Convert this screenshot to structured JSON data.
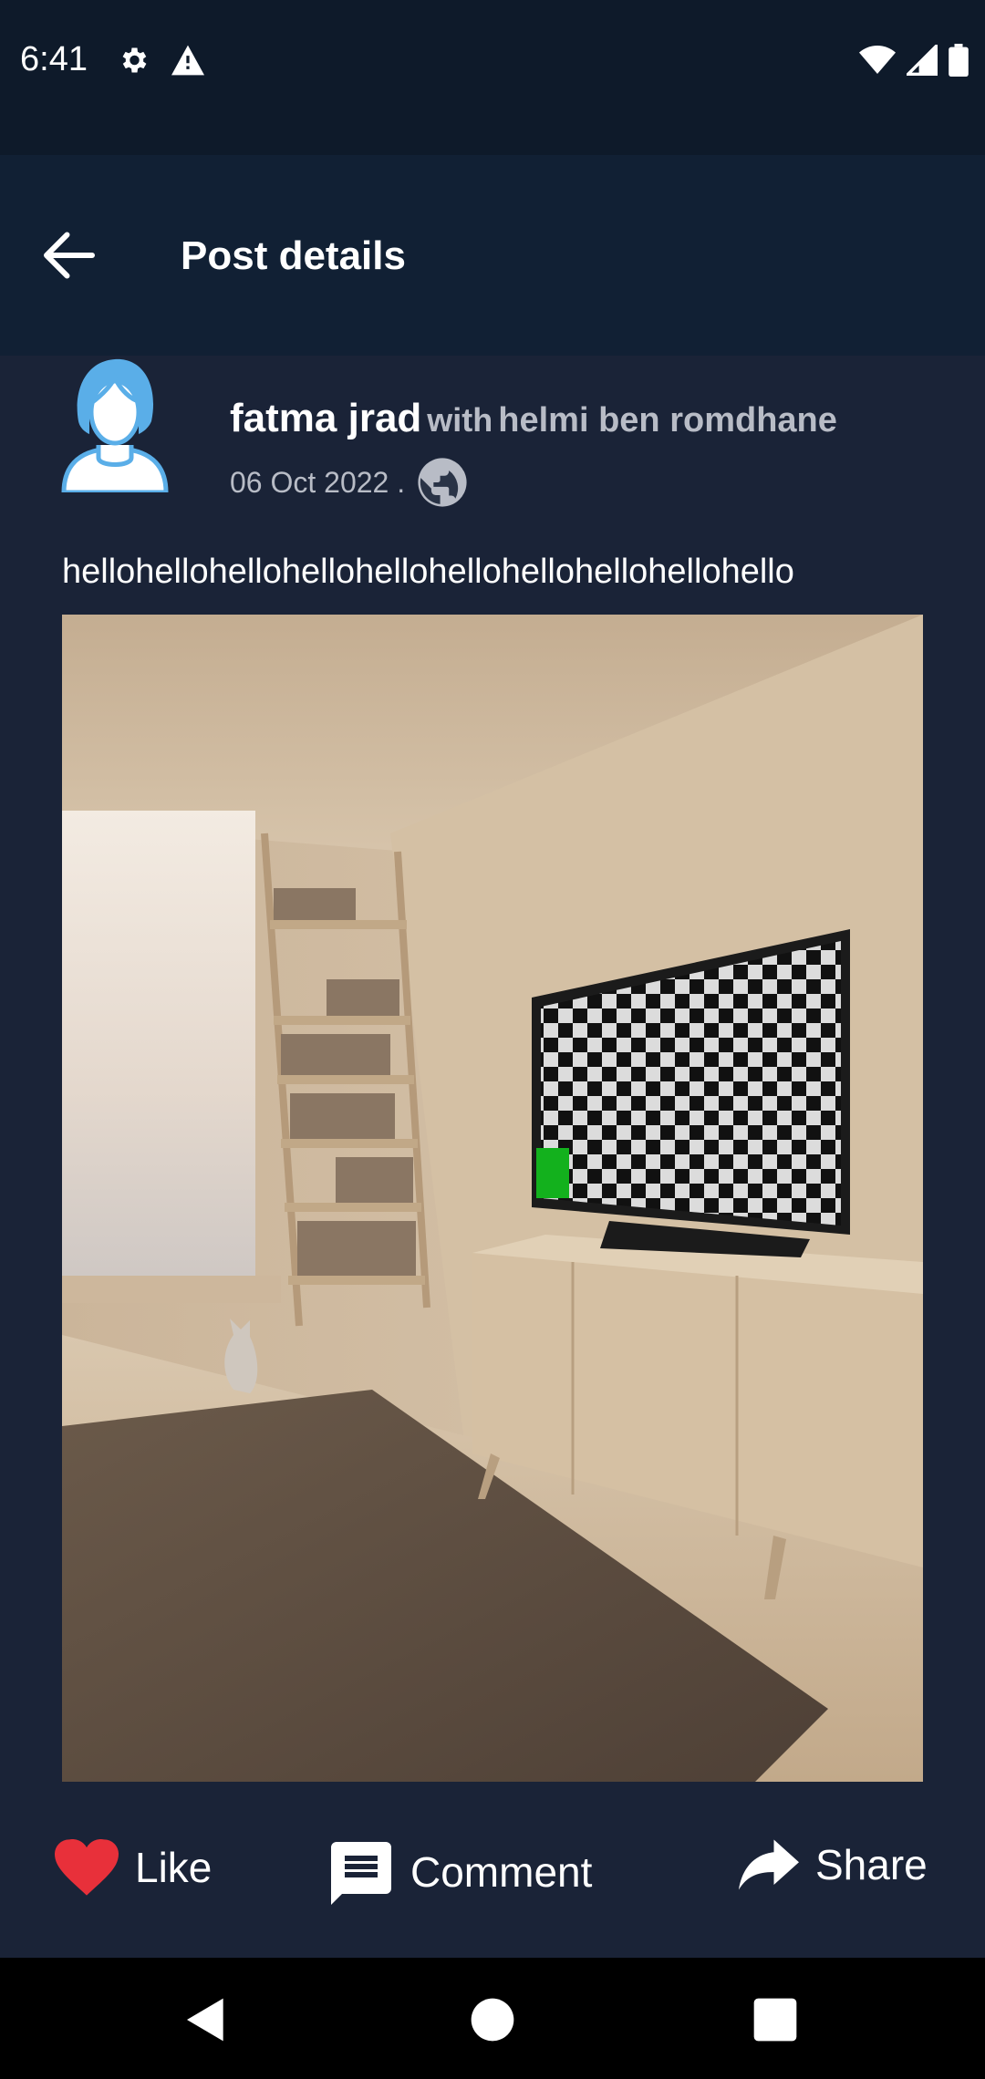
{
  "status_bar": {
    "time": "6:41",
    "icons_left": [
      "gear-icon",
      "warning-icon"
    ],
    "icons_right": [
      "wifi-icon",
      "signal-icon",
      "battery-icon"
    ]
  },
  "app_bar": {
    "back_icon": "arrow-left-icon",
    "title": "Post details"
  },
  "post": {
    "author": "fatma jrad",
    "with_label": "with",
    "tagged": "helmi ben romdhane",
    "date": "06 Oct 2022 .",
    "privacy_icon": "globe-icon",
    "text": "hellohellohellohellohellohellohellohellohellohello",
    "image_description_icon": "photo"
  },
  "actions": {
    "like": "Like",
    "comment": "Comment",
    "share": "Share"
  },
  "colors": {
    "status_bar": "#0e1a2a",
    "app_bar": "#112034",
    "background": "#1a2337",
    "like_red": "#e8303a",
    "muted_text": "#b8bcc6",
    "avatar_blue": "#5aaee8"
  }
}
